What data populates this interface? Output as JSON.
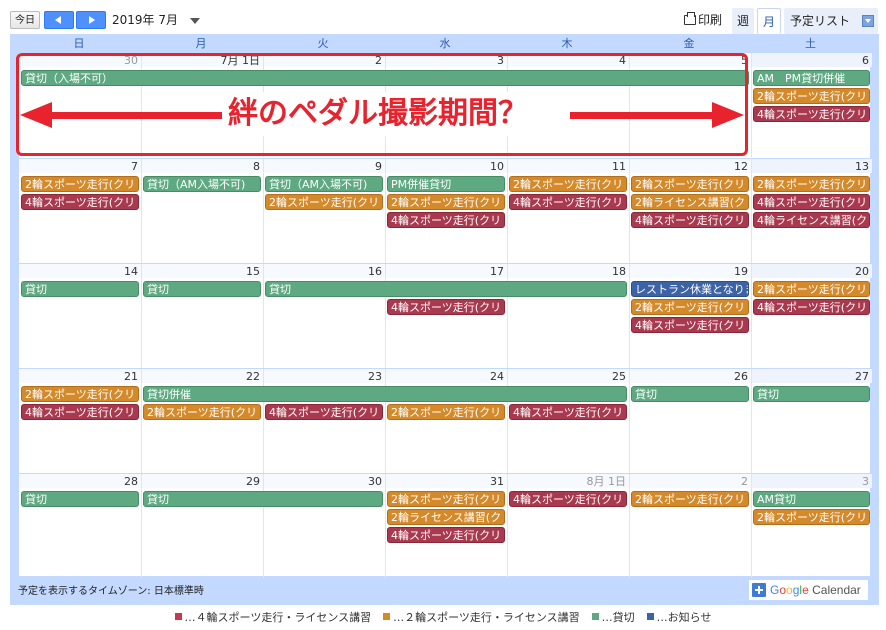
{
  "toolbar": {
    "today_label": "今日",
    "date_label": "2019年 7月",
    "print_label": "印刷",
    "view_week": "週",
    "view_month": "月",
    "view_agenda": "予定リスト"
  },
  "days_of_week": [
    "日",
    "月",
    "火",
    "水",
    "木",
    "金",
    "土"
  ],
  "weeks": [
    {
      "dates": [
        {
          "n": "30",
          "o": true
        },
        {
          "n": "7月 1日"
        },
        {
          "n": "2"
        },
        {
          "n": "3"
        },
        {
          "n": "4"
        },
        {
          "n": "5"
        },
        {
          "n": "6"
        }
      ],
      "events": [
        {
          "start": 0,
          "span": 6,
          "lane": 0,
          "color": "green",
          "title": "貸切（入場不可）"
        },
        {
          "start": 6,
          "span": 1,
          "lane": 0,
          "color": "green",
          "title": "AM　PM貸切併催"
        },
        {
          "start": 6,
          "span": 1,
          "lane": 1,
          "color": "orange",
          "title": "2輪スポーツ走行(クリ"
        },
        {
          "start": 6,
          "span": 1,
          "lane": 2,
          "color": "red",
          "title": "4輪スポーツ走行(クリ"
        }
      ]
    },
    {
      "dates": [
        {
          "n": "7"
        },
        {
          "n": "8"
        },
        {
          "n": "9"
        },
        {
          "n": "10"
        },
        {
          "n": "11"
        },
        {
          "n": "12"
        },
        {
          "n": "13"
        }
      ],
      "events": [
        {
          "start": 0,
          "span": 1,
          "lane": 0,
          "color": "orange",
          "title": "2輪スポーツ走行(クリ"
        },
        {
          "start": 0,
          "span": 1,
          "lane": 1,
          "color": "red",
          "title": "4輪スポーツ走行(クリ"
        },
        {
          "start": 1,
          "span": 1,
          "lane": 0,
          "color": "green",
          "title": "貸切（AM入場不可)"
        },
        {
          "start": 2,
          "span": 1,
          "lane": 0,
          "color": "green",
          "title": "貸切（AM入場不可)"
        },
        {
          "start": 2,
          "span": 1,
          "lane": 1,
          "color": "orange",
          "title": "2輪スポーツ走行(クリ"
        },
        {
          "start": 3,
          "span": 1,
          "lane": 0,
          "color": "green",
          "title": "PM併催貸切"
        },
        {
          "start": 3,
          "span": 1,
          "lane": 1,
          "color": "orange",
          "title": "2輪スポーツ走行(クリ"
        },
        {
          "start": 3,
          "span": 1,
          "lane": 2,
          "color": "red",
          "title": "4輪スポーツ走行(クリ"
        },
        {
          "start": 4,
          "span": 1,
          "lane": 0,
          "color": "orange",
          "title": "2輪スポーツ走行(クリ"
        },
        {
          "start": 4,
          "span": 1,
          "lane": 1,
          "color": "red",
          "title": "4輪スポーツ走行(クリ"
        },
        {
          "start": 5,
          "span": 1,
          "lane": 0,
          "color": "orange",
          "title": "2輪スポーツ走行(クリ"
        },
        {
          "start": 5,
          "span": 1,
          "lane": 1,
          "color": "orange",
          "title": "2輪ライセンス講習(ク"
        },
        {
          "start": 5,
          "span": 1,
          "lane": 2,
          "color": "red",
          "title": "4輪スポーツ走行(クリ"
        },
        {
          "start": 6,
          "span": 1,
          "lane": 0,
          "color": "orange",
          "title": "2輪スポーツ走行(クリ"
        },
        {
          "start": 6,
          "span": 1,
          "lane": 1,
          "color": "red",
          "title": "4輪スポーツ走行(クリ"
        },
        {
          "start": 6,
          "span": 1,
          "lane": 2,
          "color": "red",
          "title": "4輪ライセンス講習(ク"
        }
      ]
    },
    {
      "dates": [
        {
          "n": "14"
        },
        {
          "n": "15"
        },
        {
          "n": "16"
        },
        {
          "n": "17"
        },
        {
          "n": "18"
        },
        {
          "n": "19"
        },
        {
          "n": "20"
        }
      ],
      "events": [
        {
          "start": 0,
          "span": 1,
          "lane": 0,
          "color": "green",
          "title": "貸切"
        },
        {
          "start": 1,
          "span": 1,
          "lane": 0,
          "color": "green",
          "title": "貸切"
        },
        {
          "start": 2,
          "span": 3,
          "lane": 0,
          "color": "green",
          "title": "貸切"
        },
        {
          "start": 3,
          "span": 1,
          "lane": 1,
          "color": "red",
          "title": "4輪スポーツ走行(クリ"
        },
        {
          "start": 5,
          "span": 1,
          "lane": 0,
          "color": "blue",
          "title": "レストラン休業となりま"
        },
        {
          "start": 5,
          "span": 1,
          "lane": 1,
          "color": "orange",
          "title": "2輪スポーツ走行(クリ"
        },
        {
          "start": 5,
          "span": 1,
          "lane": 2,
          "color": "red",
          "title": "4輪スポーツ走行(クリ"
        },
        {
          "start": 6,
          "span": 1,
          "lane": 0,
          "color": "orange",
          "title": "2輪スポーツ走行(クリ"
        },
        {
          "start": 6,
          "span": 1,
          "lane": 1,
          "color": "red",
          "title": "4輪スポーツ走行(クリ"
        }
      ]
    },
    {
      "dates": [
        {
          "n": "21"
        },
        {
          "n": "22"
        },
        {
          "n": "23"
        },
        {
          "n": "24"
        },
        {
          "n": "25"
        },
        {
          "n": "26"
        },
        {
          "n": "27"
        }
      ],
      "events": [
        {
          "start": 0,
          "span": 1,
          "lane": 0,
          "color": "orange",
          "title": "2輪スポーツ走行(クリ"
        },
        {
          "start": 0,
          "span": 1,
          "lane": 1,
          "color": "red",
          "title": "4輪スポーツ走行(クリ"
        },
        {
          "start": 1,
          "span": 4,
          "lane": 0,
          "color": "green",
          "title": "貸切併催"
        },
        {
          "start": 1,
          "span": 1,
          "lane": 1,
          "color": "orange",
          "title": "2輪スポーツ走行(クリ"
        },
        {
          "start": 2,
          "span": 1,
          "lane": 1,
          "color": "red",
          "title": "4輪スポーツ走行(クリ"
        },
        {
          "start": 3,
          "span": 1,
          "lane": 1,
          "color": "orange",
          "title": "2輪スポーツ走行(クリ"
        },
        {
          "start": 4,
          "span": 1,
          "lane": 1,
          "color": "red",
          "title": "4輪スポーツ走行(クリ"
        },
        {
          "start": 5,
          "span": 1,
          "lane": 0,
          "color": "green",
          "title": "貸切"
        },
        {
          "start": 6,
          "span": 1,
          "lane": 0,
          "color": "green",
          "title": "貸切"
        }
      ]
    },
    {
      "dates": [
        {
          "n": "28"
        },
        {
          "n": "29"
        },
        {
          "n": "30"
        },
        {
          "n": "31"
        },
        {
          "n": "8月 1日",
          "o": true
        },
        {
          "n": "2",
          "o": true
        },
        {
          "n": "3",
          "o": true
        }
      ],
      "events": [
        {
          "start": 0,
          "span": 1,
          "lane": 0,
          "color": "green",
          "title": "貸切"
        },
        {
          "start": 1,
          "span": 2,
          "lane": 0,
          "color": "green",
          "title": "貸切"
        },
        {
          "start": 3,
          "span": 1,
          "lane": 0,
          "color": "orange",
          "title": "2輪スポーツ走行(クリ"
        },
        {
          "start": 3,
          "span": 1,
          "lane": 1,
          "color": "orange",
          "title": "2輪ライセンス講習(ク"
        },
        {
          "start": 3,
          "span": 1,
          "lane": 2,
          "color": "red",
          "title": "4輪スポーツ走行(クリ"
        },
        {
          "start": 4,
          "span": 1,
          "lane": 0,
          "color": "red",
          "title": "4輪スポーツ走行(クリ"
        },
        {
          "start": 5,
          "span": 1,
          "lane": 0,
          "color": "orange",
          "title": "2輪スポーツ走行(クリ"
        },
        {
          "start": 6,
          "span": 1,
          "lane": 0,
          "color": "green",
          "title": "AM貸切"
        },
        {
          "start": 6,
          "span": 1,
          "lane": 1,
          "color": "orange",
          "title": "2輪スポーツ走行(クリ"
        }
      ]
    }
  ],
  "timezone_label": "予定を表示するタイムゾーン: 日本標準時",
  "google_calendar_label": {
    "g": "G",
    "o1": "o",
    "o2": "o",
    "g2": "g",
    "l": "l",
    "e": "e",
    "rest": " Calendar"
  },
  "annotation": "絆のペダル撮影期間？",
  "legend": [
    {
      "color": "#c9364f",
      "label": "…４輪スポーツ走行・ライセンス講習"
    },
    {
      "color": "#d4892a",
      "label": "…２輪スポーツ走行・ライセンス講習"
    },
    {
      "color": "#5fa982",
      "label": "…貸切"
    },
    {
      "color": "#3c63a6",
      "label": "…お知らせ"
    }
  ]
}
